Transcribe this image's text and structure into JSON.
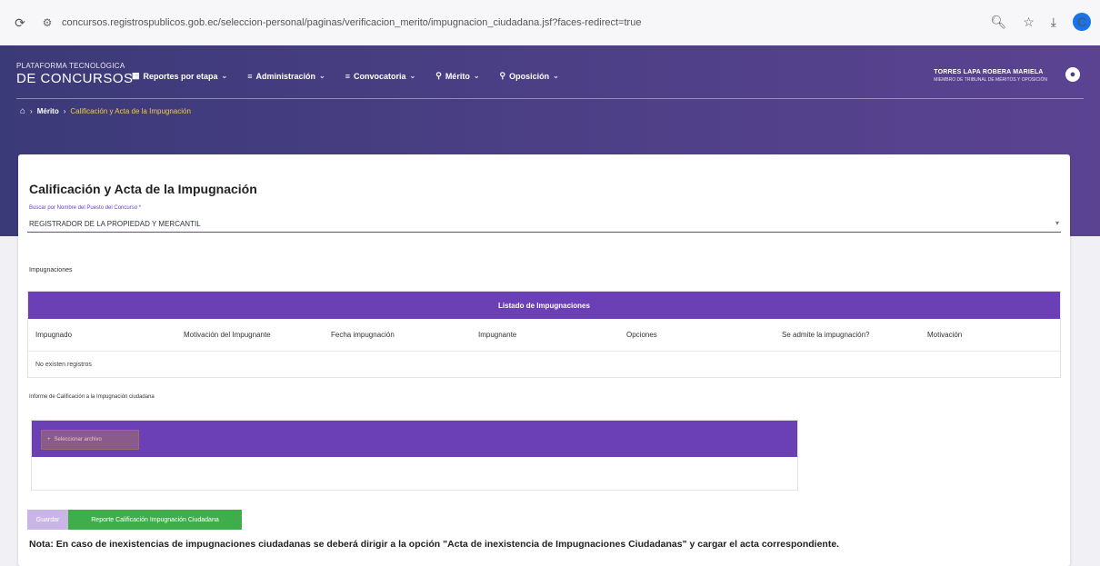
{
  "browser": {
    "url": "concursos.registrospublicos.gob.ec/seleccion-personal/paginas/verificacion_merito/impugnacion_ciudadana.jsf?faces-redirect=true",
    "profile_initial": "C"
  },
  "header": {
    "brand_small": "PLATAFORMA TECNOLÓGICA",
    "brand_big": "DE CONCURSOS",
    "nav": [
      {
        "label": "Reportes por etapa"
      },
      {
        "label": "Administración"
      },
      {
        "label": "Convocatoria"
      },
      {
        "label": "Mérito"
      },
      {
        "label": "Oposición"
      }
    ],
    "user_name": "TORRES LAPA ROBERA MARIELA",
    "user_role": "MIEMBRO DE TRIBUNAL DE MÉRITOS Y OPOSICIÓN"
  },
  "breadcrumb": {
    "items": [
      "Mérito"
    ],
    "current": "Calificación y Acta de la Impugnación"
  },
  "main": {
    "title": "Calificación y Acta de la Impugnación",
    "select_label": "Buscar por Nombre del Puesto del Concurso *",
    "select_value": "REGISTRADOR DE LA PROPIEDAD Y MERCANTIL",
    "impugnaciones_label": "Impugnaciones",
    "table": {
      "title": "Listado de Impugnaciones",
      "columns": [
        "Impugnado",
        "Motivación del Impugnante",
        "Fecha impugnación",
        "Impugnante",
        "Opciones",
        "Se admite la impugnación?",
        "Motivación"
      ],
      "empty_text": "No existen registros"
    },
    "report_label": "Informe de Calificación a la Impugnación ciudadana",
    "report_button": "Seleccionar archivo",
    "buttons": {
      "disabled": "Guardar",
      "green": "Reporte Calificación Impugnación Ciudadana"
    },
    "note": "Nota: En caso de inexistencias de impugnaciones ciudadanas se deberá dirigir a la opción \"Acta de inexistencia de Impugnaciones Ciudadanas\" y cargar el acta correspondiente."
  },
  "colors": {
    "header_start": "#3b3a78",
    "header_end": "#5b4392",
    "accent_purple": "#6b3fb6",
    "breadcrumb_current": "#f2c94c",
    "green": "#3dae49"
  }
}
